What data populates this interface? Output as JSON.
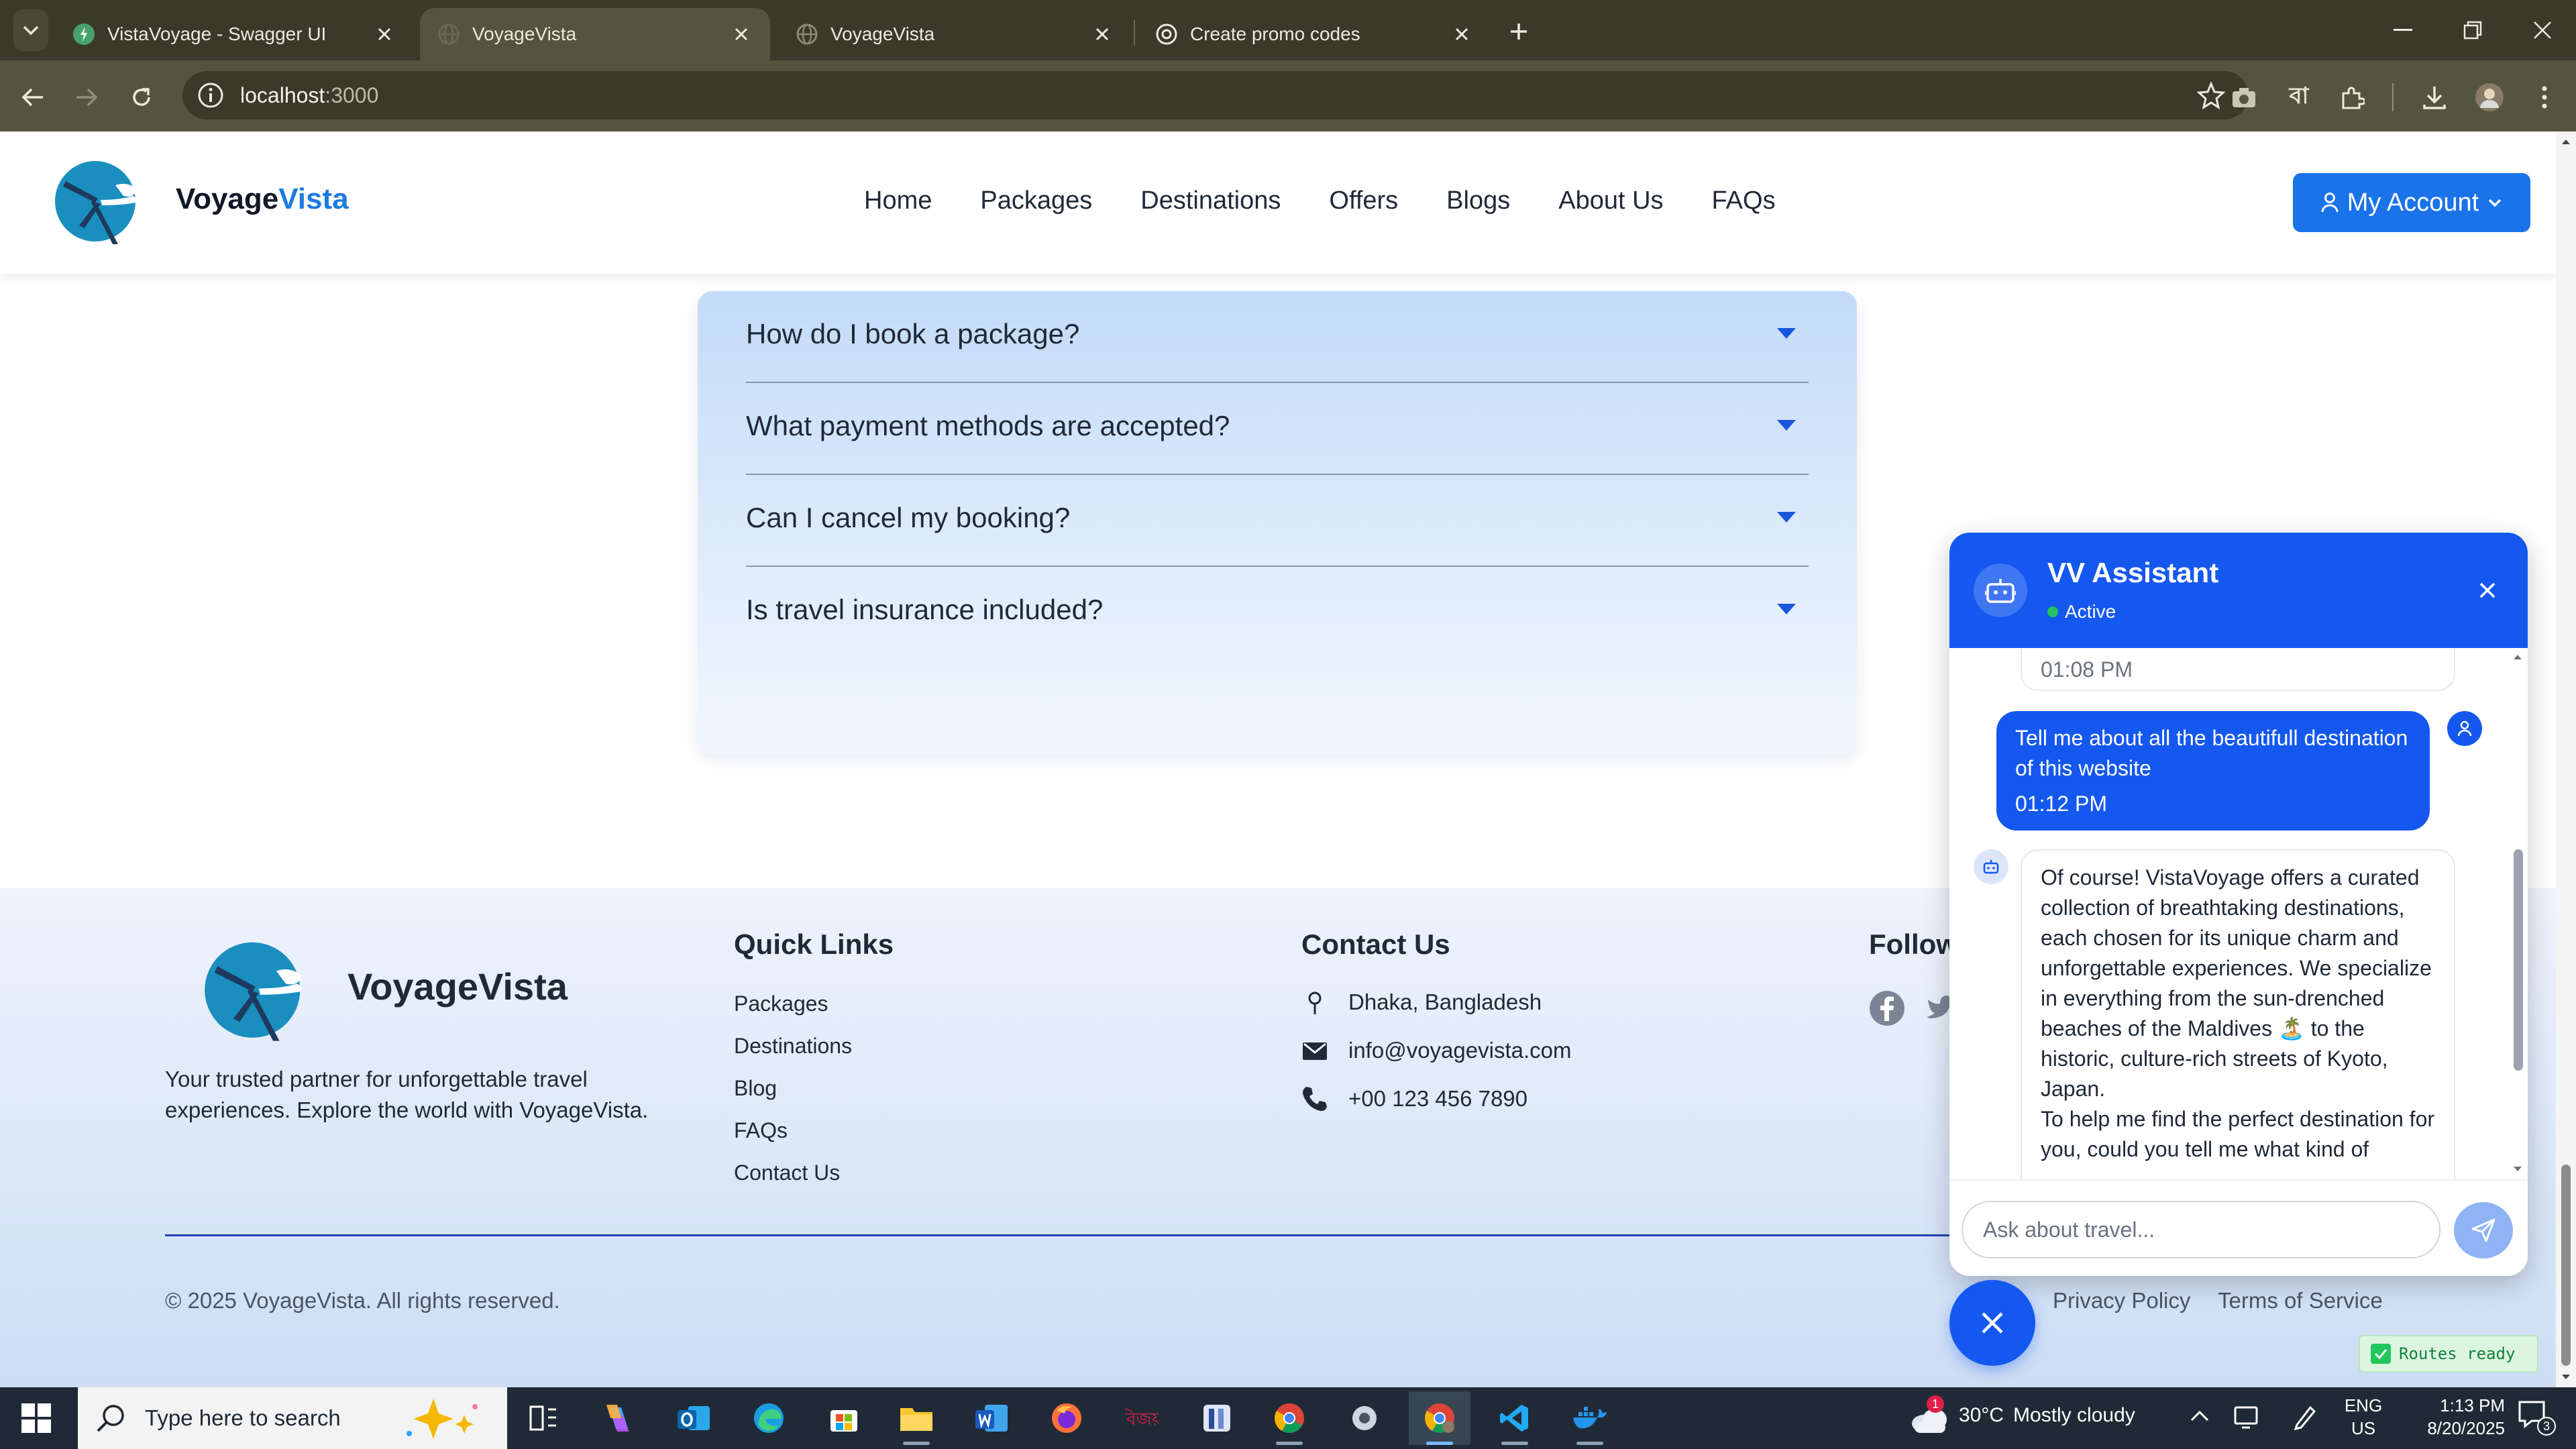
{
  "browser": {
    "tabs": [
      {
        "title": "VistaVoyage - Swagger UI",
        "active": false
      },
      {
        "title": "VoyageVista",
        "active": true
      },
      {
        "title": "VoyageVista",
        "active": false
      },
      {
        "title": "Create promo codes",
        "active": false
      }
    ],
    "url_host": "localhost",
    "url_port": ":3000"
  },
  "site": {
    "brand_part1": "Voyage",
    "brand_part2": "Vista",
    "nav": [
      "Home",
      "Packages",
      "Destinations",
      "Offers",
      "Blogs",
      "About Us",
      "FAQs"
    ],
    "account_label": "My Account"
  },
  "faq": {
    "items": [
      "How do I book a package?",
      "What payment methods are accepted?",
      "Can I cancel my booking?",
      "Is travel insurance included?"
    ]
  },
  "footer": {
    "brand": "VoyageVista",
    "description": "Your trusted partner for unforgettable travel experiences. Explore the world with VoyageVista.",
    "quick_links_title": "Quick Links",
    "quick_links": [
      "Packages",
      "Destinations",
      "Blog",
      "FAQs",
      "Contact Us"
    ],
    "contact_title": "Contact Us",
    "address": "Dhaka, Bangladesh",
    "email": "info@voyagevista.com",
    "phone": "+00 123 456 7890",
    "follow_title": "Follow",
    "copyright": "© 2025 VoyageVista. All rights reserved.",
    "privacy": "Privacy Policy",
    "terms": "Terms of Service"
  },
  "chat": {
    "title": "VV Assistant",
    "status": "Active",
    "prev_time": "01:08 PM",
    "user_message": "Tell me about all the beautifull destination of this website",
    "user_time": "01:12 PM",
    "bot_message_p1": "Of course! VistaVoyage offers a curated collection of breathtaking destinations, each chosen for its unique charm and unforgettable experiences. We specialize in everything from the sun-drenched beaches of the Maldives 🏝️ to the historic, culture-rich streets of Kyoto, Japan.",
    "bot_message_p2": "To help me find the perfect destination for you, could you tell me what kind of",
    "input_placeholder": "Ask about travel..."
  },
  "dev_badge": "Routes ready",
  "taskbar": {
    "search_placeholder": "Type here to search",
    "weather_temp": "30°C",
    "weather_desc": "Mostly cloudy",
    "weather_badge": "1",
    "lang": "ENG",
    "region": "US",
    "time": "1:13 PM",
    "date": "8/20/2025",
    "notif_count": "3"
  },
  "colors": {
    "accent_blue": "#1558f0",
    "brand_blue": "#1d7be0",
    "faq_caret": "#1a56db"
  }
}
